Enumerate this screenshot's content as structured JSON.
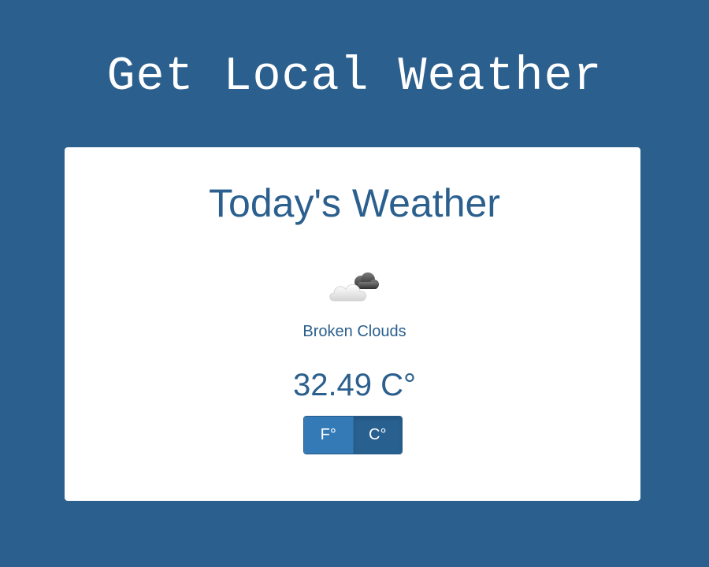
{
  "page": {
    "heading": "Get Local Weather"
  },
  "card": {
    "title": "Today's Weather",
    "icon": "broken-clouds-icon",
    "condition": "Broken Clouds",
    "temperature": "32.49 C°",
    "unit_toggle": {
      "fahrenheit_label": "F°",
      "celsius_label": "C°",
      "selected": "celsius"
    }
  },
  "colors": {
    "background": "#2b5f8d",
    "card": "#ffffff",
    "text_accent": "#2b5f8d",
    "button_primary": "#337ab7",
    "button_active": "#286090"
  }
}
